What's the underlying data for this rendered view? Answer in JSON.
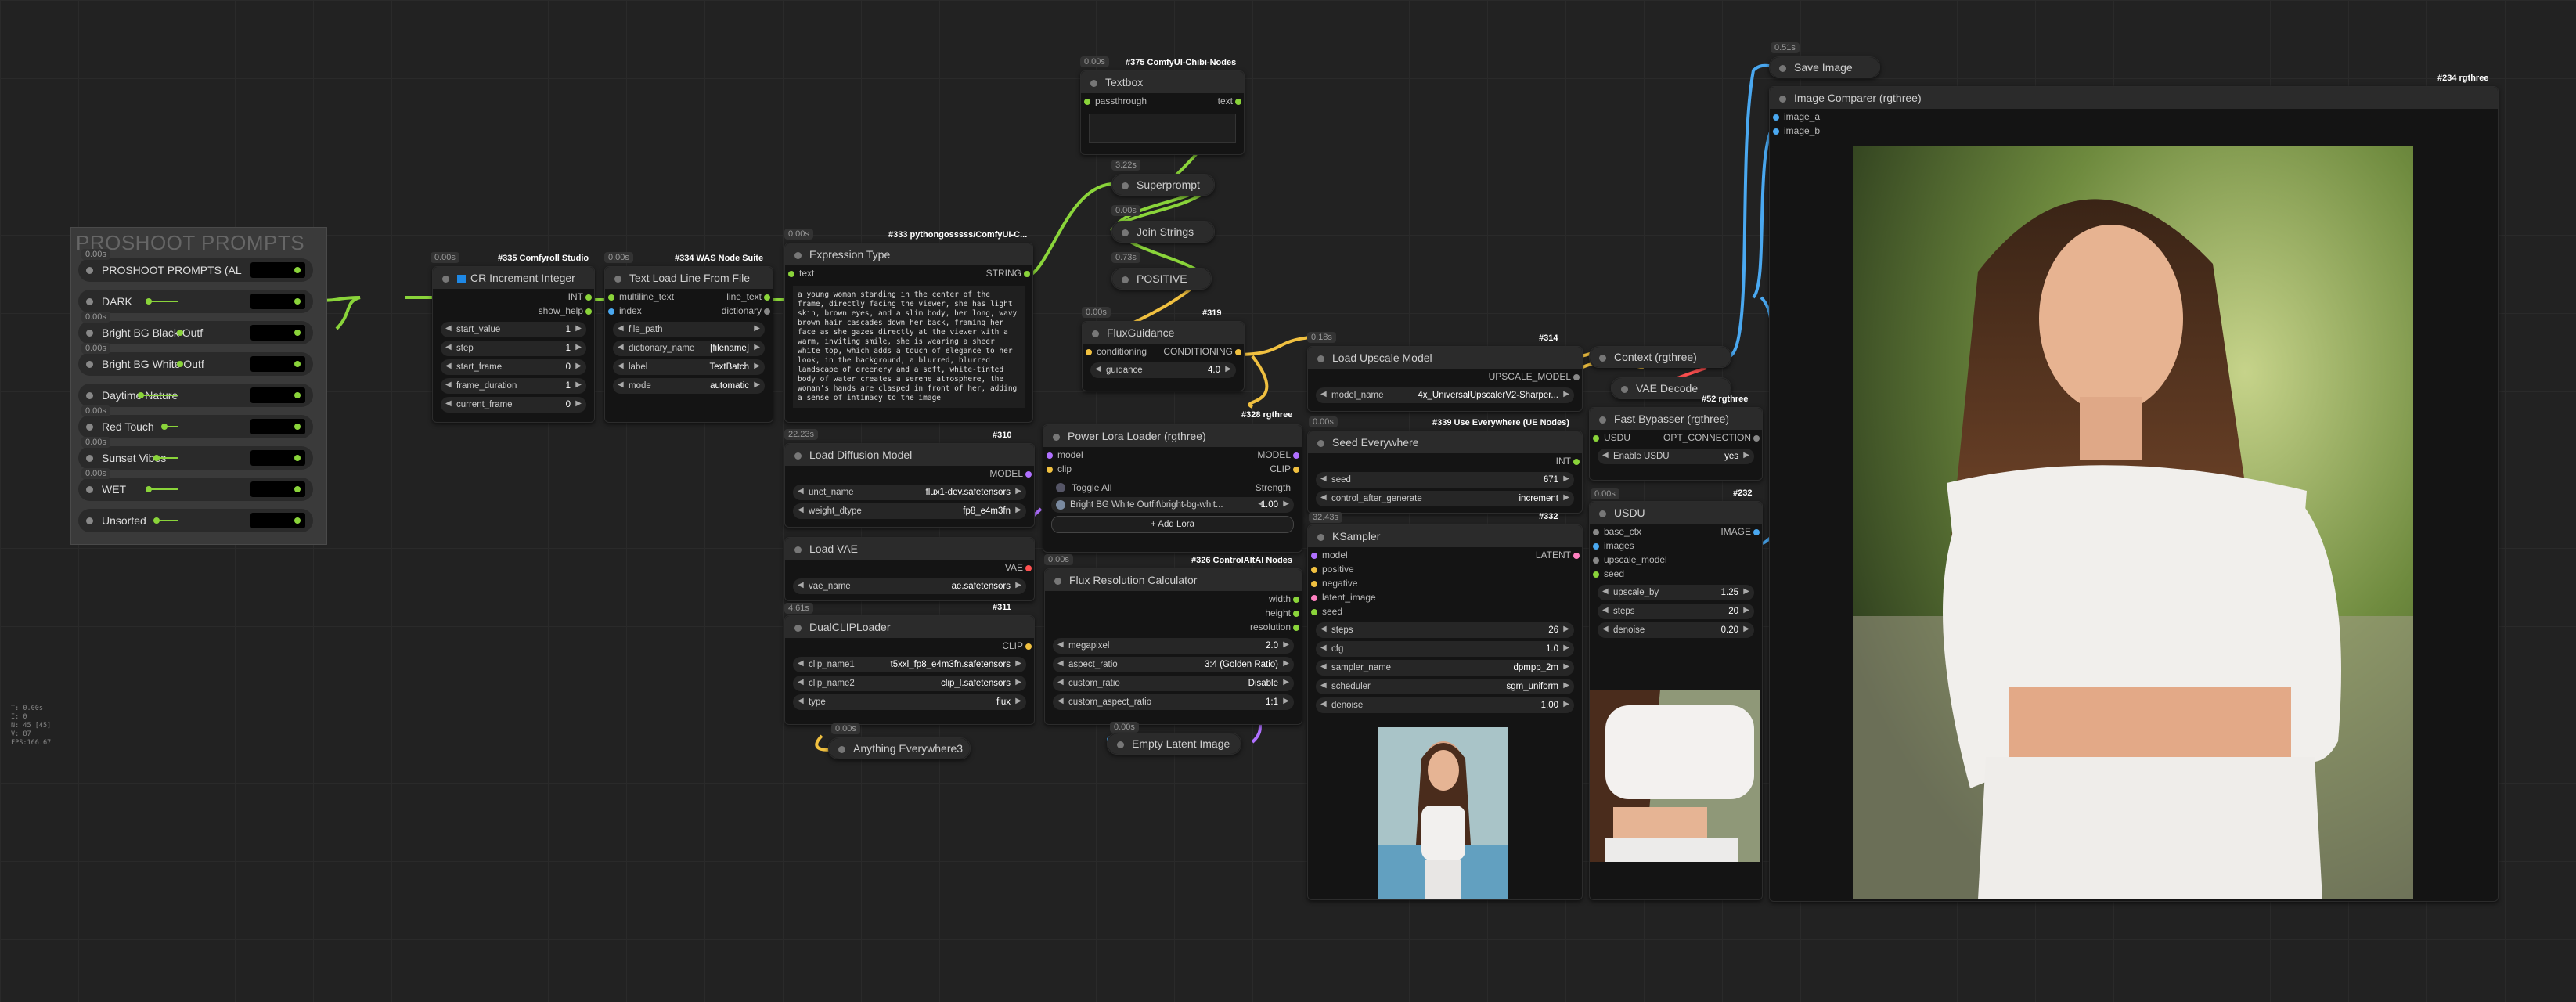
{
  "group": {
    "title": "PROSHOOT PROMPTS"
  },
  "prompt_rows": [
    {
      "label": "PROSHOOT PROMPTS (AL",
      "badge": "0.00s"
    },
    {
      "label": "DARK",
      "badge": ""
    },
    {
      "label": "Bright BG Black Outf",
      "badge": "0.00s"
    },
    {
      "label": "Bright BG White Outf",
      "badge": "0.00s"
    },
    {
      "label": "Daytime Nature",
      "badge": ""
    },
    {
      "label": "Red Touch",
      "badge": "0.00s"
    },
    {
      "label": "Sunset Vibes",
      "badge": "0.00s"
    },
    {
      "label": "WET",
      "badge": "0.00s"
    },
    {
      "label": "Unsorted",
      "badge": ""
    }
  ],
  "cr_increment": {
    "badge": "0.00s",
    "tag": "#335 Comfyroll Studio",
    "title": "CR Increment Integer",
    "outputs": [
      "INT",
      "show_help"
    ],
    "widgets": [
      {
        "label": "start_value",
        "value": "1"
      },
      {
        "label": "step",
        "value": "1"
      },
      {
        "label": "start_frame",
        "value": "0"
      },
      {
        "label": "frame_duration",
        "value": "1"
      },
      {
        "label": "current_frame",
        "value": "0"
      }
    ]
  },
  "text_load": {
    "badge": "0.00s",
    "tag": "#334 WAS Node Suite",
    "title": "Text Load Line From File",
    "inputs": [
      "multiline_text",
      "index"
    ],
    "outputs": [
      "line_text",
      "dictionary"
    ],
    "widgets": [
      {
        "label": "file_path",
        "value": ""
      },
      {
        "label": "dictionary_name",
        "value": "[filename]"
      },
      {
        "label": "label",
        "value": "TextBatch"
      },
      {
        "label": "mode",
        "value": "automatic"
      }
    ]
  },
  "expression": {
    "badge": "0.00s",
    "tag": "#333 pythongosssss/ComfyUI-C...",
    "title": "Expression Type",
    "input": "text",
    "output": "STRING",
    "text": "a young woman standing in the center of the frame, directly facing the viewer, she has light skin, brown eyes, and a slim body, her long, wavy brown hair cascades down her back, framing her face as she gazes directly at the viewer with a warm, inviting smile, she is wearing a sheer white top, which adds a touch of elegance to her look, in the background, a blurred, blurred landscape of greenery and a soft, white-tinted body of water creates a serene atmosphere, the woman's hands are clasped in front of her, adding a sense of intimacy to the image"
  },
  "textbox": {
    "badge": "0.00s",
    "tag": "#375 ComfyUI-Chibi-Nodes",
    "title": "Textbox",
    "input": "passthrough",
    "output": "text"
  },
  "superprompt": {
    "badge": "3.22s",
    "title": "Superprompt"
  },
  "join": {
    "badge": "0.00s",
    "title": "Join Strings"
  },
  "positive": {
    "badge": "0.73s",
    "title": "POSITIVE"
  },
  "flux_guidance": {
    "badge": "0.00s",
    "tag": "#319",
    "title": "FluxGuidance",
    "input": "conditioning",
    "output": "CONDITIONING",
    "widgets": [
      {
        "label": "guidance",
        "value": "4.0"
      }
    ],
    "tag2": "#328 rgthree"
  },
  "load_diffusion": {
    "badge": "22.23s",
    "tag": "#310",
    "title": "Load Diffusion Model",
    "output": "MODEL",
    "widgets": [
      {
        "label": "unet_name",
        "value": "flux1-dev.safetensors"
      },
      {
        "label": "weight_dtype",
        "value": "fp8_e4m3fn"
      }
    ]
  },
  "load_vae": {
    "badge": "0.00s",
    "title": "Load VAE",
    "output": "VAE",
    "widgets": [
      {
        "label": "vae_name",
        "value": "ae.safetensors"
      }
    ],
    "tag": "#311"
  },
  "dual_clip": {
    "badge": "4.61s",
    "title": "DualCLIPLoader",
    "output": "CLIP",
    "widgets": [
      {
        "label": "clip_name1",
        "value": "t5xxl_fp8_e4m3fn.safetensors"
      },
      {
        "label": "clip_name2",
        "value": "clip_l.safetensors"
      },
      {
        "label": "type",
        "value": "flux"
      }
    ]
  },
  "anything_everywhere": {
    "badge": "0.00s",
    "title": "Anything Everywhere3"
  },
  "power_lora": {
    "title": "Power Lora Loader (rgthree)",
    "inputs": [
      "model",
      "clip"
    ],
    "outputs": [
      "MODEL",
      "CLIP"
    ],
    "toggle_all": "Toggle All",
    "strength_label": "Strength",
    "lora": {
      "name": "Bright BG White Outfit\\bright-bg-whit...",
      "value": "1.00"
    },
    "add_button": "+ Add Lora"
  },
  "flux_res": {
    "badge": "0.00s",
    "tag": "#326 ControlAltAI Nodes",
    "title": "Flux Resolution Calculator",
    "outputs": [
      "width",
      "height",
      "resolution"
    ],
    "widgets": [
      {
        "label": "megapixel",
        "value": "2.0"
      },
      {
        "label": "aspect_ratio",
        "value": "3:4 (Golden Ratio)"
      },
      {
        "label": "custom_ratio",
        "value": "Disable"
      },
      {
        "label": "custom_aspect_ratio",
        "value": "1:1"
      }
    ]
  },
  "empty_latent": {
    "badge": "0.00s",
    "title": "Empty Latent Image"
  },
  "upscale_loader": {
    "badge": "0.18s",
    "tag": "#314",
    "title": "Load Upscale Model",
    "output": "UPSCALE_MODEL",
    "widgets": [
      {
        "label": "model_name",
        "value": "4x_UniversalUpscalerV2-Sharper..."
      }
    ]
  },
  "seed_everywhere": {
    "badge": "0.00s",
    "tag": "#339 Use Everywhere (UE Nodes)",
    "title": "Seed Everywhere",
    "output": "INT",
    "widgets": [
      {
        "label": "seed",
        "value": "671"
      },
      {
        "label": "control_after_generate",
        "value": "increment"
      }
    ]
  },
  "ksampler": {
    "badge": "32.43s",
    "tag": "#332",
    "title": "KSampler",
    "inputs": [
      "model",
      "positive",
      "negative",
      "latent_image",
      "seed"
    ],
    "output": "LATENT",
    "widgets": [
      {
        "label": "steps",
        "value": "26"
      },
      {
        "label": "cfg",
        "value": "1.0"
      },
      {
        "label": "sampler_name",
        "value": "dpmpp_2m"
      },
      {
        "label": "scheduler",
        "value": "sgm_uniform"
      },
      {
        "label": "denoise",
        "value": "1.00"
      }
    ]
  },
  "context": {
    "title": "Context (rgthree)"
  },
  "vae_decode": {
    "title": "VAE Decode",
    "tag": "#52 rgthree"
  },
  "fast_bypasser": {
    "title": "Fast Bypasser (rgthree)",
    "input": "USDU",
    "output": "OPT_CONNECTION",
    "widgets": [
      {
        "label": "Enable USDU",
        "value": "yes"
      }
    ],
    "tag": "#232"
  },
  "usdu": {
    "badge": "0.00s",
    "title": "USDU",
    "inputs": [
      "base_ctx",
      "images",
      "upscale_model",
      "seed"
    ],
    "output": "IMAGE",
    "widgets": [
      {
        "label": "upscale_by",
        "value": "1.25"
      },
      {
        "label": "steps",
        "value": "20"
      },
      {
        "label": "denoise",
        "value": "0.20"
      }
    ]
  },
  "save_image": {
    "badge": "0.51s",
    "title": "Save Image"
  },
  "comparer": {
    "tag": "#234 rgthree",
    "title": "Image Comparer (rgthree)",
    "inputs": [
      "image_a",
      "image_b"
    ]
  },
  "stats": [
    "T: 0.00s",
    "I: 0",
    "N: 45 [45]",
    "V: 87",
    "FPS:166.67"
  ],
  "colors": {
    "wire_green": "#8ad43a",
    "wire_yellow": "#f0c040",
    "wire_blue": "#4aa8f0",
    "wire_purple": "#b070ff",
    "accent_tag": "#ffffff"
  }
}
